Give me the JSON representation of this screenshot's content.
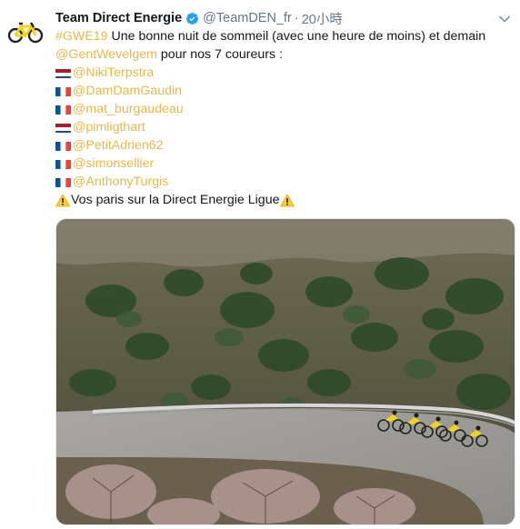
{
  "tweet": {
    "author_name": "Team Direct Energie",
    "handle": "@TeamDEN_fr",
    "separator": "·",
    "time": "20小時",
    "icons": {
      "avatar": "bicycle-icon",
      "verified": "verified-badge-icon",
      "menu": "chevron-down-icon",
      "warning": "warning-sign-icon"
    },
    "line1": {
      "hashtag": "#GWE19",
      "text": " Une bonne nuit de sommeil (avec une heure de moins) et demain"
    },
    "line2": {
      "mention": "@GentWevelgem",
      "text": " pour nos 7 coureurs :"
    },
    "riders": [
      {
        "flag": "netherlands-flag-icon",
        "mention": "@NikiTerpstra"
      },
      {
        "flag": "france-flag-icon",
        "mention": "@DamDamGaudin"
      },
      {
        "flag": "france-flag-icon",
        "mention": "@mat_burgaudeau"
      },
      {
        "flag": "netherlands-flag-icon",
        "mention": "@pimligthart"
      },
      {
        "flag": "france-flag-icon",
        "mention": "@PetitAdrien62"
      },
      {
        "flag": "france-flag-icon",
        "mention": "@simonsellier"
      },
      {
        "flag": "france-flag-icon",
        "mention": "@AnthonyTurgis"
      }
    ],
    "closing": "Vos paris sur la Direct Energie Ligue",
    "photo": {
      "subject": "cyclists-on-mountain-road-photo"
    }
  },
  "colors": {
    "link": "#e8b84a",
    "text": "#14171a",
    "muted": "#657786",
    "verified": "#1da1f2",
    "avatar_yellow": "#f4d31a"
  }
}
